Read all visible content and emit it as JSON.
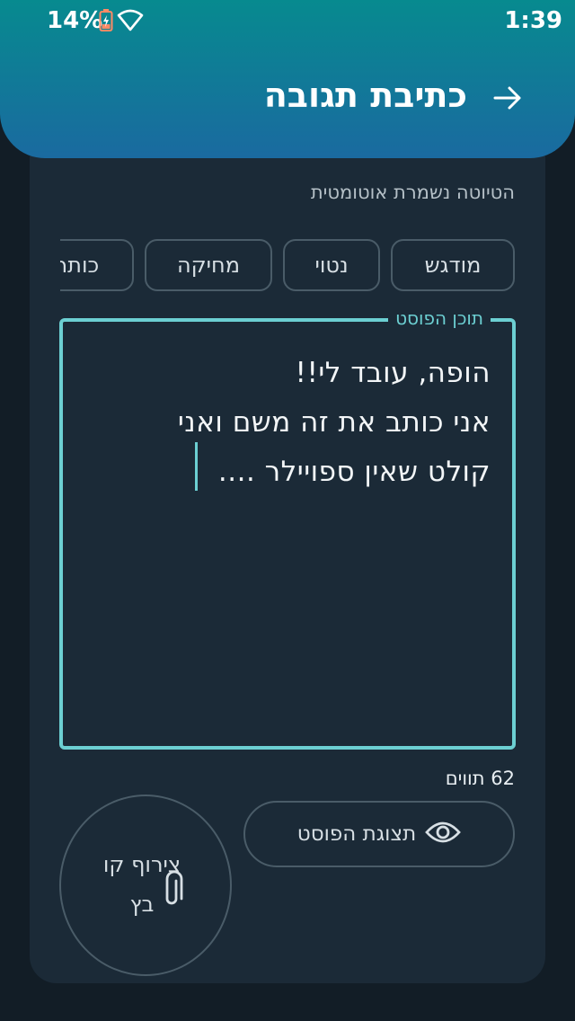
{
  "status_bar": {
    "battery": "14%",
    "time": "1:39",
    "icons": [
      "battery-charging-icon",
      "wifi-icon"
    ]
  },
  "header": {
    "title": "כתיבת תגובה",
    "back_icon": "arrow-right-icon"
  },
  "draft_note": "הטיוטה נשמרת אוטומטית",
  "format_chips": [
    {
      "label": "מודגש"
    },
    {
      "label": "נטוי"
    },
    {
      "label": "מחיקה"
    },
    {
      "label": "כותרת"
    }
  ],
  "post_field": {
    "label": "תוכן הפוסט",
    "lines": [
      "הופה, עובד לי!!",
      "אני כותב את זה משם ואני",
      "קולט שאין ספויילר ...."
    ]
  },
  "char_count": "62 תווים",
  "preview_button": {
    "label": "תצוגת הפוסט",
    "icon": "eye-icon"
  },
  "attach_button": {
    "label": "צירוף קובץ",
    "icon": "paperclip-icon"
  },
  "colors": {
    "header_top": "#078a8f",
    "header_bottom": "#1a6aa0",
    "accent": "#6ccfd2",
    "card": "#1b2a37",
    "background": "#121d26"
  }
}
